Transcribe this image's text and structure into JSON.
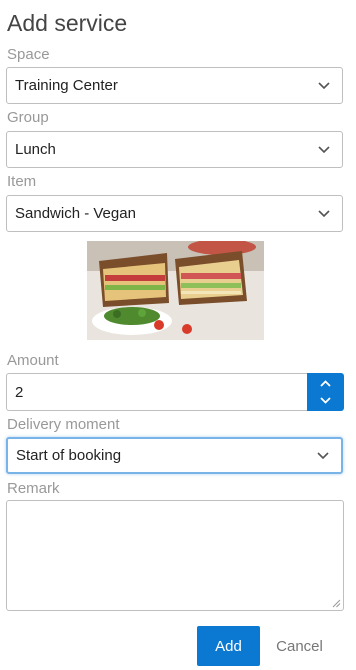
{
  "title": "Add service",
  "space": {
    "label": "Space",
    "value": "Training Center"
  },
  "group": {
    "label": "Group",
    "value": "Lunch"
  },
  "item": {
    "label": "Item",
    "value": "Sandwich - Vegan",
    "image_icon": "sandwich-photo"
  },
  "amount": {
    "label": "Amount",
    "value": "2"
  },
  "delivery": {
    "label": "Delivery moment",
    "value": "Start of booking"
  },
  "remark": {
    "label": "Remark",
    "value": ""
  },
  "actions": {
    "add": "Add",
    "cancel": "Cancel"
  },
  "colors": {
    "accent": "#0b78d1",
    "focus_border": "#79b4e8",
    "label": "#999999"
  }
}
